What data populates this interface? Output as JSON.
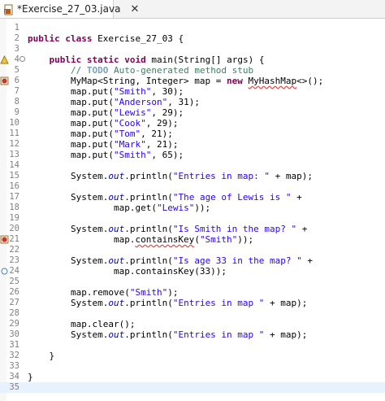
{
  "tab": {
    "title": "*Exercise_27_03.java",
    "close": "✕",
    "icon": "java-file-icon"
  },
  "editor": {
    "lines": [
      {
        "n": "1",
        "code": ""
      },
      {
        "n": "2",
        "code": "public class Exercise_27_03 {"
      },
      {
        "n": "3",
        "code": ""
      },
      {
        "n": "4",
        "code": "    public static void main(String[] args) {"
      },
      {
        "n": "5",
        "code": "        // TODO Auto-generated method stub"
      },
      {
        "n": "6",
        "code": "        MyMap<String, Integer> map = new MyHashMap<>();"
      },
      {
        "n": "7",
        "code": "        map.put(\"Smith\", 30);"
      },
      {
        "n": "8",
        "code": "        map.put(\"Anderson\", 31);"
      },
      {
        "n": "9",
        "code": "        map.put(\"Lewis\", 29);"
      },
      {
        "n": "10",
        "code": "        map.put(\"Cook\", 29);"
      },
      {
        "n": "11",
        "code": "        map.put(\"Tom\", 21);"
      },
      {
        "n": "12",
        "code": "        map.put(\"Mark\", 21);"
      },
      {
        "n": "13",
        "code": "        map.put(\"Smith\", 65);"
      },
      {
        "n": "14",
        "code": ""
      },
      {
        "n": "15",
        "code": "        System.out.println(\"Entries in map: \" + map);"
      },
      {
        "n": "16",
        "code": ""
      },
      {
        "n": "17",
        "code": "        System.out.println(\"The age of Lewis is \" +"
      },
      {
        "n": "18",
        "code": "                map.get(\"Lewis\"));"
      },
      {
        "n": "19",
        "code": ""
      },
      {
        "n": "20",
        "code": "        System.out.println(\"Is Smith in the map? \" +"
      },
      {
        "n": "21",
        "code": "                map.containsKey(\"Smith\"));"
      },
      {
        "n": "22",
        "code": ""
      },
      {
        "n": "23",
        "code": "        System.out.println(\"Is age 33 in the map? \" +"
      },
      {
        "n": "24",
        "code": "                map.containsKey(33));"
      },
      {
        "n": "25",
        "code": ""
      },
      {
        "n": "26",
        "code": "        map.remove(\"Smith\");"
      },
      {
        "n": "27",
        "code": "        System.out.println(\"Entries in map \" + map);"
      },
      {
        "n": "28",
        "code": ""
      },
      {
        "n": "29",
        "code": "        map.clear();"
      },
      {
        "n": "30",
        "code": "        System.out.println(\"Entries in map \" + map);"
      },
      {
        "n": "31",
        "code": ""
      },
      {
        "n": "32",
        "code": "    }"
      },
      {
        "n": "33",
        "code": ""
      },
      {
        "n": "34",
        "code": "}"
      },
      {
        "n": "35",
        "code": ""
      }
    ],
    "current_line": "35",
    "fold_lines": [
      "4"
    ],
    "markers": [
      {
        "line": "4",
        "kind": "warning-icon"
      },
      {
        "line": "6",
        "kind": "error-icon"
      },
      {
        "line": "21",
        "kind": "error-icon"
      },
      {
        "line": "24",
        "kind": "breakpoint-icon"
      }
    ],
    "colors": {
      "keyword": "#7f0055",
      "string": "#2a00ff",
      "comment": "#3f7f5f",
      "static_field": "#0000c0",
      "line_number": "#808080",
      "current_line_bg": "#e8f2fe"
    }
  }
}
